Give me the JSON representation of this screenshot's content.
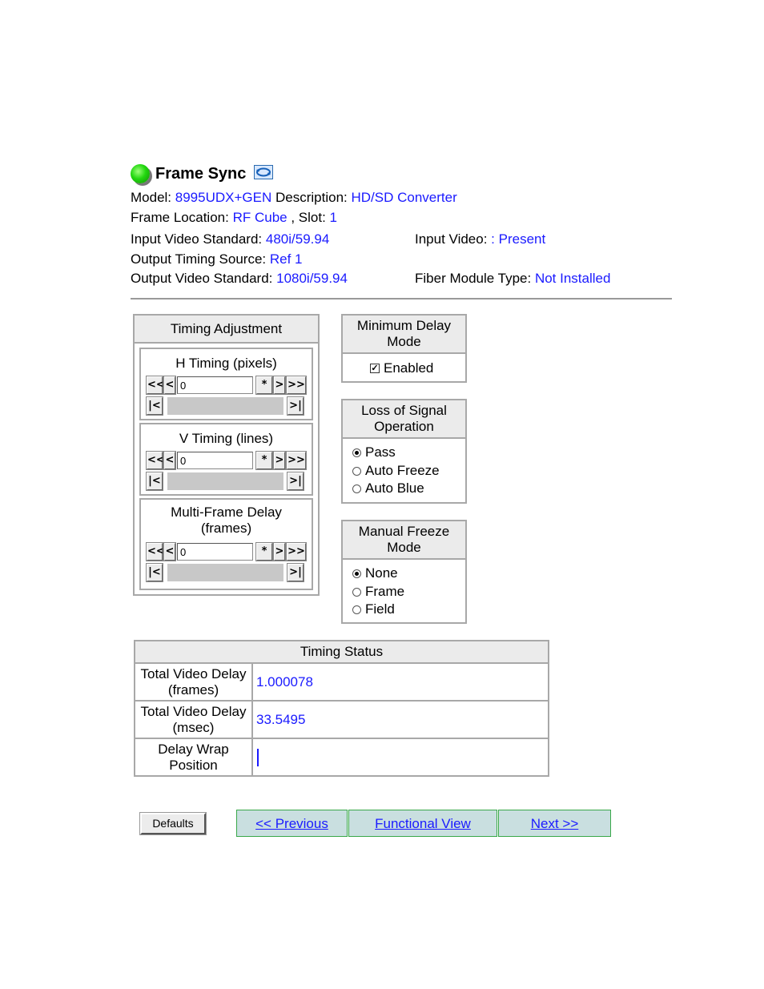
{
  "header": {
    "title": "Frame Sync",
    "status_icon": "green-status-led",
    "refresh_icon": "refresh-icon"
  },
  "info": {
    "model_label": "Model:",
    "model_value": "8995UDX+GEN",
    "description_label": "Description:",
    "description_value": "HD/SD Converter",
    "frame_location_label": "Frame Location:",
    "frame_location_value": "RF Cube",
    "slot_label": ", Slot:",
    "slot_value": "1",
    "input_std_label": "Input Video Standard:",
    "input_std_value": "480i/59.94",
    "input_video_label": "Input Video:",
    "input_video_value": ": Present",
    "output_timing_label": "Output Timing Source:",
    "output_timing_value": "Ref 1",
    "output_std_label": "Output Video Standard:",
    "output_std_value": "1080i/59.94",
    "fiber_label": "Fiber Module Type:",
    "fiber_value": "Not Installed"
  },
  "timing_adjustment": {
    "title": "Timing Adjustment",
    "h_timing": {
      "label": "H Timing (pixels)",
      "value": "0"
    },
    "v_timing": {
      "label": "V Timing (lines)",
      "value": "0"
    },
    "multi_frame": {
      "label_line1": "Multi-Frame Delay",
      "label_line2": "(frames)",
      "value": "0"
    },
    "buttons": {
      "fast_back": "<<",
      "back": "<",
      "reset": "*",
      "forward": ">",
      "fast_forward": ">>",
      "min": "|<",
      "max": ">|"
    }
  },
  "min_delay": {
    "title_line1": "Minimum Delay",
    "title_line2": "Mode",
    "checkbox_label": "Enabled",
    "checked": true
  },
  "loss_of_signal": {
    "title_line1": "Loss of Signal",
    "title_line2": "Operation",
    "options": [
      "Pass",
      "Auto Freeze",
      "Auto Blue"
    ],
    "selected": "Pass"
  },
  "manual_freeze": {
    "title_line1": "Manual Freeze",
    "title_line2": "Mode",
    "options": [
      "None",
      "Frame",
      "Field"
    ],
    "selected": "None"
  },
  "timing_status": {
    "title": "Timing Status",
    "rows": [
      {
        "label_line1": "Total Video Delay",
        "label_line2": "(frames)",
        "value": "1.000078"
      },
      {
        "label_line1": "Total Video Delay",
        "label_line2": "(msec)",
        "value": "33.5495"
      },
      {
        "label_line1": "Delay Wrap",
        "label_line2": "Position",
        "value": ""
      }
    ]
  },
  "footer": {
    "defaults": "Defaults",
    "previous": "<< Previous",
    "functional_view": "Functional View",
    "next": "Next >>"
  }
}
